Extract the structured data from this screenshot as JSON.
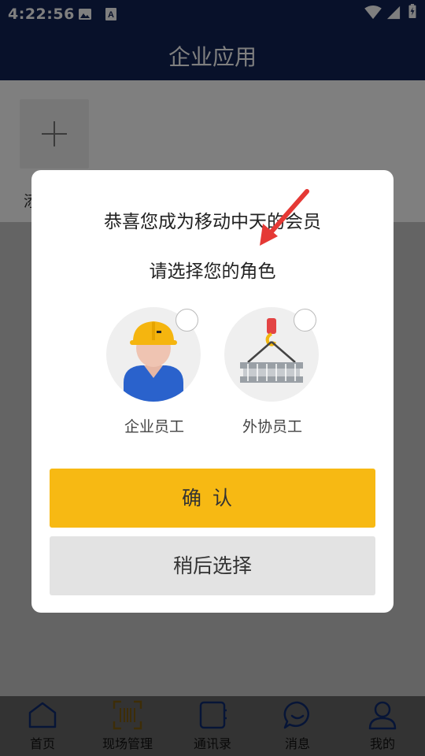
{
  "status_bar": {
    "time": "4:22:56",
    "icons": [
      "image-icon",
      "a-keyboard-icon",
      "wifi-icon",
      "signal-icon",
      "battery-charging-icon"
    ]
  },
  "header": {
    "title": "企业应用"
  },
  "content": {
    "add_label": "添"
  },
  "dialog": {
    "title": "恭喜您成为移动中天的会员",
    "subtitle": "请选择您的角色",
    "roles": [
      {
        "label": "企业员工",
        "icon": "worker-avatar-icon",
        "selected": false
      },
      {
        "label": "外协员工",
        "icon": "crane-hook-icon",
        "selected": false
      }
    ],
    "confirm_label": "确认",
    "later_label": "稍后选择"
  },
  "tabbar": {
    "items": [
      {
        "label": "首页",
        "icon": "home-icon"
      },
      {
        "label": "现场管理",
        "icon": "barcode-scan-icon"
      },
      {
        "label": "通讯录",
        "icon": "contacts-book-icon"
      },
      {
        "label": "消息",
        "icon": "chat-bubble-icon"
      },
      {
        "label": "我的",
        "icon": "person-icon"
      }
    ]
  },
  "colors": {
    "header_bg": "#112254",
    "confirm_button": "#f7b913",
    "later_button": "#e3e3e3",
    "annotation_arrow": "#e53935"
  }
}
